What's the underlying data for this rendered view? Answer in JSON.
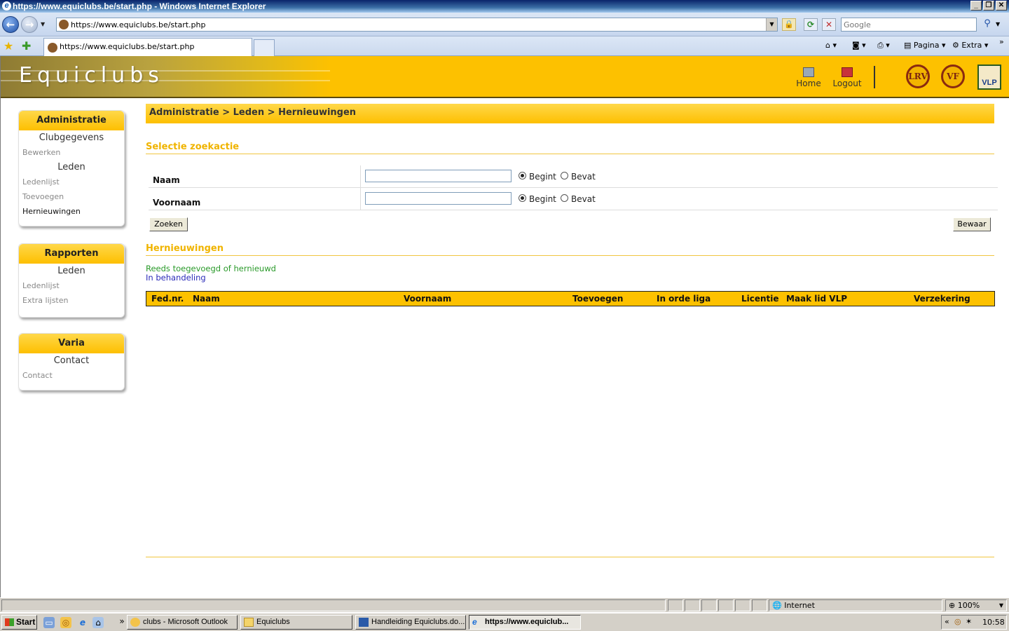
{
  "window": {
    "title": "https://www.equiclubs.be/start.php - Windows Internet Explorer",
    "controls": [
      "_",
      "❐",
      "✕"
    ]
  },
  "browser": {
    "address": "https://www.equiclubs.be/start.php",
    "search_placeholder": "Google",
    "tab_title": "https://www.equiclubs.be/start.php",
    "commands": {
      "page": "Pagina",
      "extra": "Extra"
    }
  },
  "site": {
    "title": "Equiclubs",
    "nav": {
      "home": "Home",
      "logout": "Logout"
    }
  },
  "sidebar": {
    "administratie": {
      "header": "Administratie",
      "groups": [
        {
          "title": "Clubgegevens",
          "links": [
            "Bewerken"
          ]
        },
        {
          "title": "Leden",
          "links": [
            "Ledenlijst",
            "Toevoegen",
            "Hernieuwingen"
          ]
        }
      ]
    },
    "rapporten": {
      "header": "Rapporten",
      "groups": [
        {
          "title": "Leden",
          "links": [
            "Ledenlijst",
            "Extra lijsten"
          ]
        }
      ]
    },
    "varia": {
      "header": "Varia",
      "groups": [
        {
          "title": "Contact",
          "links": [
            "Contact"
          ]
        }
      ]
    }
  },
  "main": {
    "breadcrumb": "Administratie > Leden > Hernieuwingen",
    "selection_title": "Selectie zoekactie",
    "fields": [
      {
        "label": "Naam",
        "value": "",
        "options": [
          "Begint",
          "Bevat"
        ],
        "selected": "Begint"
      },
      {
        "label": "Voornaam",
        "value": "",
        "options": [
          "Begint",
          "Bevat"
        ],
        "selected": "Begint"
      }
    ],
    "search_button": "Zoeken",
    "save_button": "Bewaar",
    "renewals_title": "Hernieuwingen",
    "legend": {
      "done": "Reeds toegevoegd of hernieuwd",
      "in_progress": "In behandeling"
    },
    "columns": [
      "Fed.nr.",
      "Naam",
      "Voornaam",
      "Toevoegen",
      "In orde liga",
      "Licentie",
      "Maak lid VLP",
      "Verzekering"
    ]
  },
  "statusbar": {
    "zone": "Internet",
    "zoom": "100%"
  },
  "taskbar": {
    "start": "Start",
    "tasks": [
      {
        "label": "clubs - Microsoft Outlook",
        "active": false
      },
      {
        "label": "Equiclubs",
        "active": false
      },
      {
        "label": "Handleiding Equiclubs.do...",
        "active": false
      },
      {
        "label": "https://www.equiclub...",
        "active": true
      }
    ],
    "clock": "10:58"
  },
  "colors": {
    "accent": "#fdc100",
    "section_title": "#f0b400",
    "legend_done": "#2a9a2a",
    "legend_in_progress": "#2a2ab8"
  }
}
